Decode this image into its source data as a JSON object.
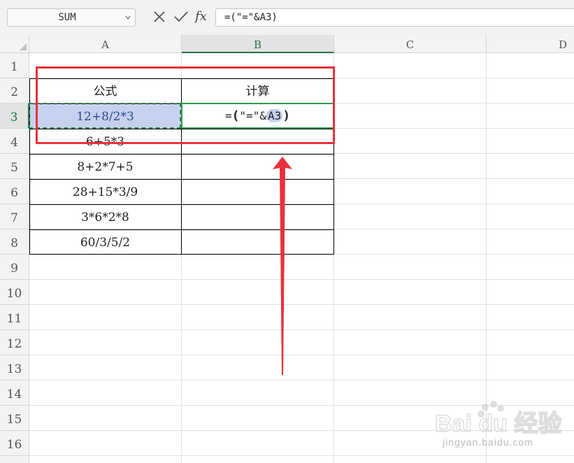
{
  "formula_bar": {
    "name_box": "SUM",
    "cancel_icon": "x-icon",
    "enter_icon": "check-icon",
    "fx_label": "fx",
    "formula": "=(\"=\"&A3)"
  },
  "columns": [
    "A",
    "B",
    "C",
    "D"
  ],
  "rows": [
    "1",
    "2",
    "3",
    "4",
    "5",
    "6",
    "7",
    "8",
    "9",
    "10",
    "11",
    "12",
    "13",
    "14",
    "15",
    "16"
  ],
  "active_column": "B",
  "active_row": "3",
  "cells": {
    "A2": "公式",
    "B2": "计算",
    "A3": "12+8/2*3",
    "A4": "6+5*3",
    "A5": "8+2*7+5",
    "A6": "28+15*3/9",
    "A7": "3*6*2*8",
    "A8": "60/3/5/2"
  },
  "editing_cell": {
    "address": "B3",
    "open_paren": "(",
    "string_part": "\"=\"&",
    "reference": "A3",
    "close_paren": ")",
    "prefix": "="
  },
  "colors": {
    "annotation_red": "#e8313a",
    "selection_fill": "#c6d1ef",
    "active_green": "#217346"
  },
  "watermark": {
    "logo": "Bai du 经验",
    "url": "jingyan.baidu.com"
  }
}
